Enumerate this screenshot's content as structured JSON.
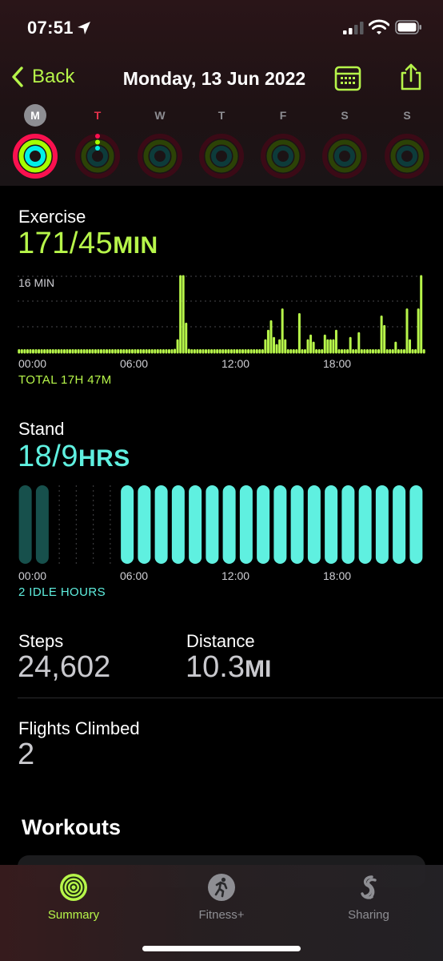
{
  "status_bar": {
    "time": "07:51"
  },
  "nav": {
    "back_label": "Back",
    "title": "Monday, 13 Jun 2022"
  },
  "week": {
    "days": [
      {
        "letter": "M",
        "state": "selected"
      },
      {
        "letter": "T",
        "state": "today"
      },
      {
        "letter": "W",
        "state": "normal"
      },
      {
        "letter": "T",
        "state": "normal"
      },
      {
        "letter": "F",
        "state": "normal"
      },
      {
        "letter": "S",
        "state": "normal"
      },
      {
        "letter": "S",
        "state": "normal"
      }
    ]
  },
  "exercise": {
    "label": "Exercise",
    "value": "171/45",
    "unit": "MIN",
    "scale_label": "16 MIN",
    "x_labels": [
      "00:00",
      "06:00",
      "12:00",
      "18:00"
    ],
    "caption": "TOTAL 17H 47M",
    "color": "#b7f64a"
  },
  "stand": {
    "label": "Stand",
    "value": "18/9",
    "unit": "HRS",
    "x_labels": [
      "00:00",
      "06:00",
      "12:00",
      "18:00"
    ],
    "caption": "2 IDLE HOURS",
    "color": "#5ff0e0"
  },
  "steps": {
    "label": "Steps",
    "value": "24,602"
  },
  "distance": {
    "label": "Distance",
    "value": "10.3",
    "unit": "MI"
  },
  "flights": {
    "label": "Flights Climbed",
    "value": "2"
  },
  "workouts": {
    "title": "Workouts"
  },
  "tabs": [
    {
      "label": "Summary",
      "icon": "activity-rings-icon",
      "active": true
    },
    {
      "label": "Fitness+",
      "icon": "fitness-plus-icon",
      "active": false
    },
    {
      "label": "Sharing",
      "icon": "sharing-icon",
      "active": false
    }
  ],
  "chart_data": [
    {
      "type": "bar",
      "title": "Exercise",
      "ylabel": "MIN",
      "ylim": [
        0,
        16
      ],
      "x_range": [
        "00:00",
        "24:00"
      ],
      "x_ticks": [
        "00:00",
        "06:00",
        "12:00",
        "18:00"
      ],
      "bins_per_hour": 4,
      "values": [
        0.3,
        0.3,
        0.3,
        0.3,
        0.3,
        0.3,
        0.3,
        0.3,
        0.3,
        0.3,
        0.3,
        0.3,
        0.3,
        0.3,
        0.3,
        0.3,
        0.3,
        0.3,
        0.3,
        0.3,
        0.3,
        0.3,
        0.3,
        0.3,
        0.3,
        0.3,
        0.3,
        0.3,
        0.3,
        0.3,
        0.3,
        0.3,
        0.3,
        0.3,
        0.3,
        0.3,
        0.3,
        0.3,
        0.3,
        0.3,
        0.3,
        0.3,
        0.3,
        0.3,
        0.3,
        0.3,
        0.3,
        0.3,
        0.3,
        0.3,
        0.3,
        0.3,
        0.3,
        0.3,
        0.3,
        0.5,
        2.5,
        16,
        16,
        6,
        0.5,
        0.3,
        0.3,
        0.4,
        0.3,
        0.4,
        0.3,
        0.3,
        0.4,
        0.3,
        0.3,
        0.3,
        0.3,
        0.3,
        0.3,
        0.3,
        0.3,
        0.3,
        0.3,
        0.3,
        0.3,
        0.3,
        0.3,
        0.3,
        0.3,
        0.3,
        0.3,
        2.5,
        4.5,
        6.5,
        3,
        1.5,
        2.5,
        9,
        2.5,
        0.3,
        0.3,
        0.3,
        0.3,
        8,
        0.3,
        0.3,
        2.5,
        3.5,
        2,
        0.3,
        0.3,
        0.3,
        3.5,
        2.5,
        2.5,
        2.5,
        4.5,
        0.3,
        0.3,
        0.3,
        0.3,
        3,
        0.3,
        0.3,
        4,
        0.3,
        0.3,
        0.3,
        0.3,
        0.3,
        0.3,
        0.3,
        7.5,
        5.5,
        0.3,
        0.3,
        0.3,
        2,
        0.3,
        0.3,
        0.3,
        9,
        2.5,
        0.3,
        0.3,
        9,
        16,
        0.3
      ]
    },
    {
      "type": "bar",
      "title": "Stand",
      "ylabel": "HRS",
      "x_range": [
        "00:00",
        "24:00"
      ],
      "x_ticks": [
        "00:00",
        "06:00",
        "12:00",
        "18:00"
      ],
      "categories": [
        "00",
        "01",
        "02",
        "03",
        "04",
        "05",
        "06",
        "07",
        "08",
        "09",
        "10",
        "11",
        "12",
        "13",
        "14",
        "15",
        "16",
        "17",
        "18",
        "19",
        "20",
        "21",
        "22",
        "23"
      ],
      "values": [
        "idle",
        "idle",
        "none",
        "none",
        "none",
        "none",
        "stood",
        "stood",
        "stood",
        "stood",
        "stood",
        "stood",
        "stood",
        "stood",
        "stood",
        "stood",
        "stood",
        "stood",
        "stood",
        "stood",
        "stood",
        "stood",
        "stood",
        "stood"
      ]
    }
  ]
}
